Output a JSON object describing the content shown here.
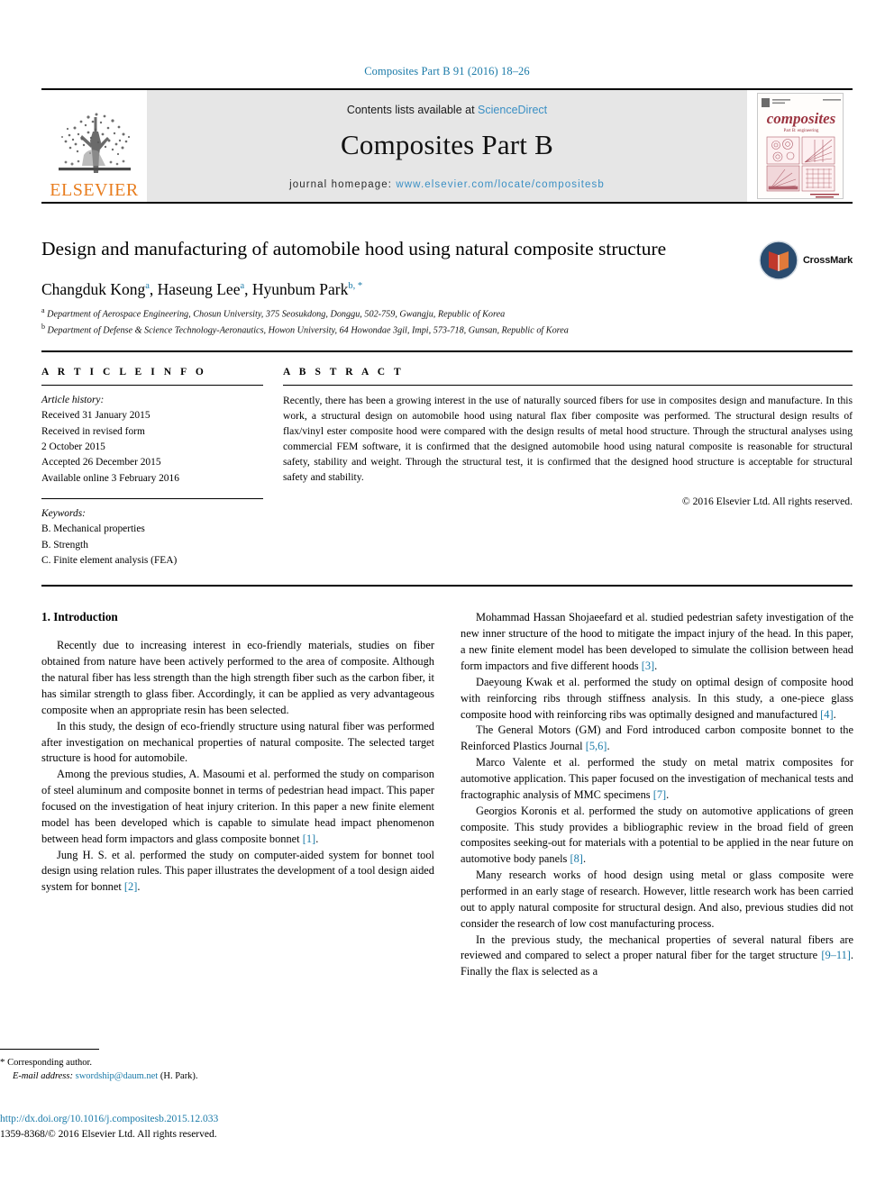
{
  "running_head": "Composites Part B 91 (2016) 18–26",
  "masthead": {
    "publisher_logo_name": "elsevier-tree-logo",
    "publisher_wordmark": "ELSEVIER",
    "contents_prefix": "Contents lists available at",
    "contents_link": "ScienceDirect",
    "journal_title": "Composites Part B",
    "homepage_prefix": "journal homepage:",
    "homepage_url": "www.elsevier.com/locate/compositesb",
    "cover_wordmark": "composites",
    "cover_subtitle": "Part B: engineering",
    "link_color": "#3a8fc4"
  },
  "article": {
    "title": "Design and manufacturing of automobile hood using natural composite structure",
    "crossmark_label": "CrossMark",
    "authors": [
      {
        "name": "Changduk Kong",
        "marker": "a"
      },
      {
        "name": "Haseung Lee",
        "marker": "a"
      },
      {
        "name": "Hyunbum Park",
        "marker": "b, *"
      }
    ],
    "affiliations": [
      {
        "marker": "a",
        "text": "Department of Aerospace Engineering, Chosun University, 375 Seosukdong, Donggu, 502-759, Gwangju, Republic of Korea"
      },
      {
        "marker": "b",
        "text": "Department of Defense & Science Technology-Aeronautics, Howon University, 64 Howondae 3gil, Impi, 573-718, Gunsan, Republic of Korea"
      }
    ]
  },
  "info": {
    "heading": "A R T I C L E   I N F O",
    "history_label": "Article history:",
    "history": [
      "Received 31 January 2015",
      "Received in revised form",
      "2 October 2015",
      "Accepted 26 December 2015",
      "Available online 3 February 2016"
    ],
    "keywords_label": "Keywords:",
    "keywords": [
      "B. Mechanical properties",
      "B. Strength",
      "C. Finite element analysis (FEA)"
    ]
  },
  "abstract": {
    "heading": "A B S T R A C T",
    "text": "Recently, there has been a growing interest in the use of naturally sourced fibers for use in composites design and manufacture. In this work, a structural design on automobile hood using natural flax fiber composite was performed. The structural design results of flax/vinyl ester composite hood were compared with the design results of metal hood structure. Through the structural analyses using commercial FEM software, it is confirmed that the designed automobile hood using natural composite is reasonable for structural safety, stability and weight. Through the structural test, it is confirmed that the designed hood structure is acceptable for structural safety and stability.",
    "copyright": "© 2016 Elsevier Ltd. All rights reserved."
  },
  "body": {
    "section_heading": "1. Introduction",
    "left_paragraphs": [
      "Recently due to increasing interest in eco-friendly materials, studies on fiber obtained from nature have been actively performed to the area of composite. Although the natural fiber has less strength than the high strength fiber such as the carbon fiber, it has similar strength to glass fiber. Accordingly, it can be applied as very advantageous composite when an appropriate resin has been selected.",
      "In this study, the design of eco-friendly structure using natural fiber was performed after investigation on mechanical properties of natural composite. The selected target structure is hood for automobile.",
      "Among the previous studies, A. Masoumi et al. performed the study on comparison of steel aluminum and composite bonnet in terms of pedestrian head impact. This paper focused on the investigation of heat injury criterion. In this paper a new finite element model has been developed which is capable to simulate head impact phenomenon between head form impactors and glass composite bonnet [1].",
      "Jung H. S. et al. performed the study on computer-aided system for bonnet tool design using relation rules. This paper illustrates the development of a tool design aided system for bonnet [2]."
    ],
    "right_paragraphs": [
      "Mohammad Hassan Shojaeefard et al. studied pedestrian safety investigation of the new inner structure of the hood to mitigate the impact injury of the head. In this paper, a new finite element model has been developed to simulate the collision between head form impactors and five different hoods [3].",
      "Daeyoung Kwak et al. performed the study on optimal design of composite hood with reinforcing ribs through stiffness analysis. In this study, a one-piece glass composite hood with reinforcing ribs was optimally designed and manufactured [4].",
      "The General Motors (GM) and Ford introduced carbon composite bonnet to the Reinforced Plastics Journal [5,6].",
      "Marco Valente et al. performed the study on metal matrix composites for automotive application. This paper focused on the investigation of mechanical tests and fractographic analysis of MMC specimens [7].",
      "Georgios Koronis et al. performed the study on automotive applications of green composite. This study provides a bibliographic review in the broad field of green composites seeking-out for materials with a potential to be applied in the near future on automotive body panels [8].",
      "Many research works of hood design using metal or glass composite were performed in an early stage of research. However, little research work has been carried out to apply natural composite for structural design. And also, previous studies did not consider the research of low cost manufacturing process.",
      "In the previous study, the mechanical properties of several natural fibers are reviewed and compared to select a proper natural fiber for the target structure [9–11]. Finally the flax is selected as a"
    ]
  },
  "footnote": {
    "corresponding_marker": "*",
    "corresponding_text": "Corresponding author.",
    "email_label": "E-mail address:",
    "email": "swordship@daum.net",
    "email_owner": "(H. Park)."
  },
  "footer": {
    "doi": "http://dx.doi.org/10.1016/j.compositesb.2015.12.033",
    "issn_line": "1359-8368/© 2016 Elsevier Ltd. All rights reserved."
  }
}
